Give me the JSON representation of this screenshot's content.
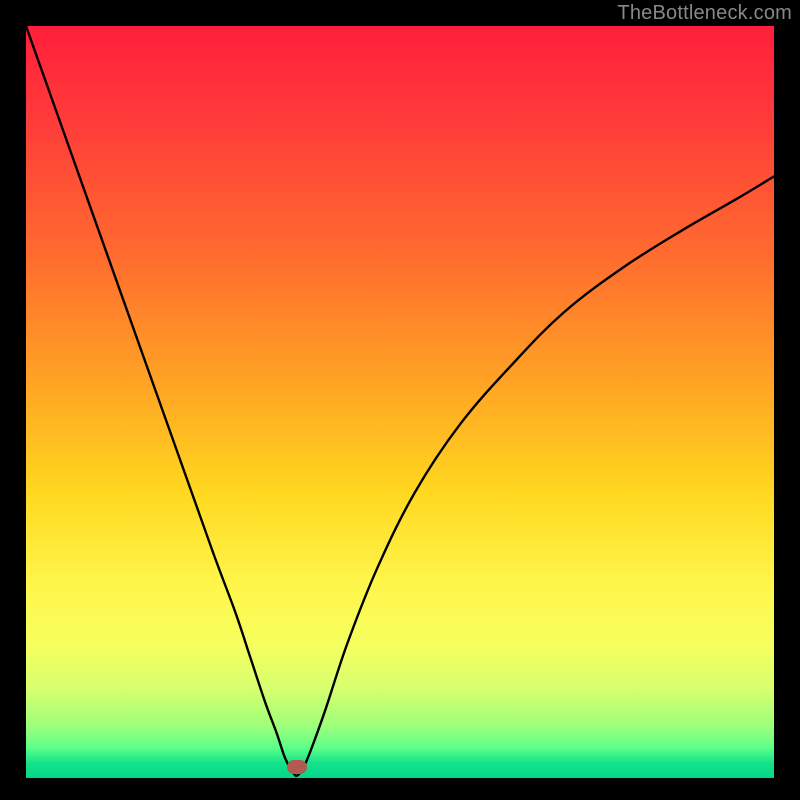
{
  "watermark": "TheBottleneck.com",
  "marker": {
    "x_pct": 36.2,
    "y_pct": 98.6
  },
  "chart_data": {
    "type": "line",
    "title": "",
    "xlabel": "",
    "ylabel": "",
    "xlim": [
      0,
      100
    ],
    "ylim": [
      0,
      100
    ],
    "grid": false,
    "legend": false,
    "series": [
      {
        "name": "bottleneck-curve",
        "x": [
          0,
          5,
          10,
          15,
          20,
          25,
          28,
          30,
          32,
          33.5,
          34.5,
          35.2,
          35.8,
          36.2,
          37,
          38,
          40,
          43,
          47,
          52,
          58,
          65,
          72,
          80,
          88,
          95,
          100
        ],
        "y": [
          100,
          86,
          72,
          58,
          44,
          30,
          22,
          16,
          10,
          6,
          3,
          1.5,
          0.6,
          0.3,
          1.2,
          3.5,
          9,
          18,
          28,
          38,
          47,
          55,
          62,
          68,
          73,
          77,
          80
        ]
      }
    ],
    "annotations": [
      {
        "type": "marker",
        "x": 36.2,
        "y": 0.3,
        "label": "optimal-point"
      }
    ],
    "background_gradient_stops": [
      {
        "pct": 0,
        "color": "#ff1f3a"
      },
      {
        "pct": 12,
        "color": "#ff3a3a"
      },
      {
        "pct": 30,
        "color": "#ff6a2f"
      },
      {
        "pct": 48,
        "color": "#ffa524"
      },
      {
        "pct": 62,
        "color": "#ffd81f"
      },
      {
        "pct": 74,
        "color": "#fff54a"
      },
      {
        "pct": 82,
        "color": "#f6ff5e"
      },
      {
        "pct": 88,
        "color": "#d8ff6e"
      },
      {
        "pct": 93,
        "color": "#9fff7a"
      },
      {
        "pct": 96,
        "color": "#5cff88"
      },
      {
        "pct": 98,
        "color": "#14e38a"
      },
      {
        "pct": 100,
        "color": "#00d68b"
      }
    ]
  }
}
